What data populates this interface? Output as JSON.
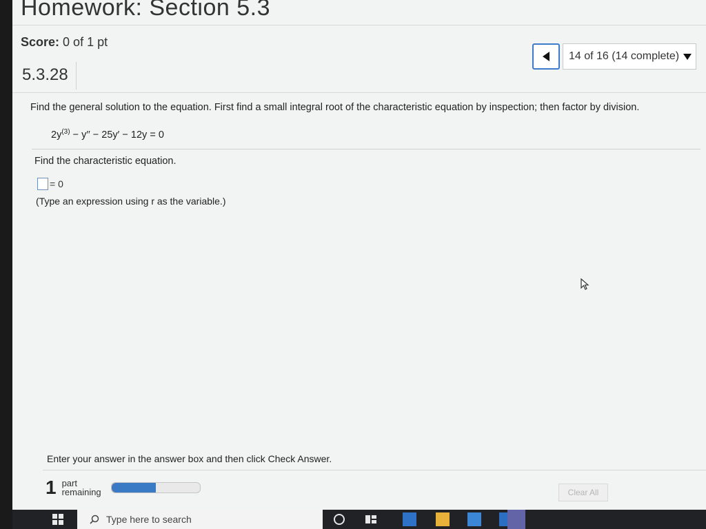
{
  "header": {
    "title": "Homework: Section 5.3",
    "score_label": "Score:",
    "score_value": "0 of 1 pt"
  },
  "nav": {
    "question_selector": "14 of 16 (14 complete)"
  },
  "question": {
    "number": "5.3.28",
    "instruction": "Find the general solution to the equation. First find a small integral root of the characteristic equation by inspection; then factor by division.",
    "equation_prefix": "2y",
    "equation_superscript": "(3)",
    "equation_rest": " − y′′ − 25y′ − 12y = 0",
    "prompt": "Find the characteristic equation.",
    "answer_suffix": "= 0",
    "hint": "(Type an expression using r as the variable.)"
  },
  "footer": {
    "message": "Enter your answer in the answer box and then click Check Answer.",
    "parts_count": "1",
    "parts_label_line1": "part",
    "parts_label_line2": "remaining",
    "progress_fraction": 0.5,
    "clear_all_label": "Clear All"
  },
  "taskbar": {
    "search_placeholder": "Type here to search"
  },
  "icons": {
    "prev": "chevron-left-icon",
    "dropdown": "caret-down-icon",
    "cursor": "mouse-pointer-icon",
    "windows": "windows-logo-icon",
    "search": "search-icon",
    "cortana": "cortana-circle-icon",
    "taskview": "task-view-icon"
  },
  "colors": {
    "accent_blue": "#3a79c4",
    "taskbar": "#202225"
  }
}
